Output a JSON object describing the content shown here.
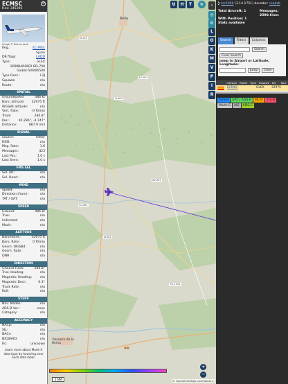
{
  "left": {
    "callsign": "ECMSC",
    "hex": "Hex: 345395",
    "photo_credit": "Image © Ramon Jordi",
    "top_rows": [
      {
        "label": "Reg.:",
        "value": "EC-MSC"
      },
      {
        "label": "",
        "value": "Spain"
      },
      {
        "label": "DB flags:",
        "value": "LADD"
      },
      {
        "label": "Type:",
        "value": "GLEX"
      },
      {
        "label": "",
        "value": "BOMBARDIER BD-700"
      },
      {
        "label": "",
        "value": "Global 6000/6500"
      },
      {
        "label": "Type Desc.:",
        "value": "L2J"
      },
      {
        "label": "Squawk:",
        "value": "n/a"
      },
      {
        "label": "Route:",
        "value": "n/a"
      }
    ],
    "sections": [
      {
        "title": "SPATIAL",
        "rows": [
          {
            "label": "Groundspeed:",
            "value": "486 kt"
          },
          {
            "label": "Baro. altitude:",
            "value": "32975 ft"
          },
          {
            "label": "WGS84 altitude:",
            "value": "n/a"
          },
          {
            "label": "Vert. Rate:",
            "value": "-0 ft/min"
          },
          {
            "label": "Track:",
            "value": "284.8°"
          },
          {
            "label": "Pos.:",
            "value": "40.286°, -4.747°"
          },
          {
            "label": "Distance:",
            "value": "887.9 nmi"
          }
        ]
      },
      {
        "title": "SIGNAL",
        "rows": [
          {
            "label": "Source:",
            "value": "Other"
          },
          {
            "label": "RSSI:",
            "value": "n/a"
          },
          {
            "label": "Msg. Rate:",
            "value": "1.6"
          },
          {
            "label": "Messages:",
            "value": "423"
          },
          {
            "label": "Last Pos.:",
            "value": "1.0 s"
          },
          {
            "label": "Last Seen:",
            "value": "1.0 s"
          }
        ]
      },
      {
        "title": "FMS SEL",
        "rows": [
          {
            "label": "Sel. Alt.:",
            "value": "n/a"
          },
          {
            "label": "Sel. Head.:",
            "value": "n/a"
          }
        ]
      },
      {
        "title": "WIND",
        "rows": [
          {
            "label": "Speed:",
            "value": "n/a"
          },
          {
            "label": "Direction (from):",
            "value": "n/a"
          },
          {
            "label": "TAT / OAT:",
            "value": "n/a"
          }
        ]
      },
      {
        "title": "SPEED",
        "rows": [
          {
            "label": "Ground:",
            "value": "486 kt"
          },
          {
            "label": "True:",
            "value": "n/a"
          },
          {
            "label": "Indicated:",
            "value": "n/a"
          },
          {
            "label": "Mach:",
            "value": "n/a"
          }
        ]
      },
      {
        "title": "ALTITUDE",
        "rows": [
          {
            "label": "Barometric:",
            "value": "32975 ft"
          },
          {
            "label": "Baro. Rate:",
            "value": "0 ft/min"
          },
          {
            "label": "Geom. WGS84:",
            "value": "n/a"
          },
          {
            "label": "Geom. Rate:",
            "value": "n/a"
          },
          {
            "label": "QNH:",
            "value": "n/a"
          }
        ]
      },
      {
        "title": "DIRECTION",
        "rows": [
          {
            "label": "Ground Track:",
            "value": "284.8°"
          },
          {
            "label": "True Heading:",
            "value": "n/a"
          },
          {
            "label": "Magnetic Heading:",
            "value": "n/a"
          },
          {
            "label": "Magnetic Decl.:",
            "value": "0.3°"
          },
          {
            "label": "Track Rate:",
            "value": "n/a"
          },
          {
            "label": "Roll:",
            "value": "n/a"
          }
        ]
      },
      {
        "title": "STUFF",
        "rows": [
          {
            "label": "Nav. Modes:",
            "value": "n/a"
          },
          {
            "label": "ADS-B Ver.:",
            "value": "none"
          },
          {
            "label": "Category:",
            "value": "n/a"
          }
        ]
      },
      {
        "title": "ACCURACY",
        "rows": [
          {
            "label": "NACp:",
            "value": "n/a"
          },
          {
            "label": "SIL:",
            "value": "n/a"
          },
          {
            "label": "NACv:",
            "value": "n/a"
          },
          {
            "label": "NICBARO:",
            "value": "n/a"
          },
          {
            "label": "Rc:",
            "value": "unknown"
          }
        ]
      }
    ],
    "footer": "Learn more about Mode S data type by hovering over each data label."
  },
  "map": {
    "top_buttons": [
      "U",
      "H",
      "T"
    ],
    "side_buttons": [
      "L",
      "O",
      "K",
      "M",
      "V",
      "P",
      "I",
      "R"
    ],
    "scale_label": "2 NM",
    "attribution": "© OpenStreetMap contributors.",
    "zoom_in": "+",
    "zoom_out": "−",
    "places": [
      "Ávila",
      "Talavera de la Reina"
    ],
    "roads": [
      "N-110",
      "AV-500",
      "N-403",
      "AV-902",
      "CL-501",
      "N-502",
      "TO-1251",
      "A-5"
    ]
  },
  "right": {
    "version_link": "tar1090",
    "version_text": "(3.14.1751) decoder:",
    "decoder_link": "readsb",
    "total_aircraft": "Total Aircraft: 1",
    "messages": "Messages: 2590.6/sec",
    "with_position": "With Position: 1",
    "stats": "Stats available",
    "tabs": [
      "Search",
      "Filters",
      "Columns"
    ],
    "search_button": "Search",
    "clear_search": "Clear Search",
    "jump_label": "Jump to Airport or Latitude, Longitude:",
    "jump_button": "Jump",
    "clear_button": "Clear",
    "table_headers": [
      "Callsign",
      "Route",
      "Type",
      "Squawk",
      "Alt. (ft)",
      "Spd."
    ],
    "table_row": {
      "flag": "ES",
      "callsign": "ECMSC",
      "type": "GLEX",
      "alt": "32975"
    },
    "source_tags": [
      {
        "label": "ADS-B",
        "color": "#1e90ff"
      },
      {
        "label": "UAT / ADS-R",
        "color": "#5fd35f"
      },
      {
        "label": "MLAT",
        "color": "#ffa500"
      },
      {
        "label": "TIS-B",
        "color": "#ff4d6d"
      },
      {
        "label": "Mode-S",
        "color": "#cccccc"
      },
      {
        "label": "AIS",
        "color": "#b3b3b3"
      },
      {
        "label": "ADS-C",
        "color": "#9acd32"
      }
    ]
  }
}
